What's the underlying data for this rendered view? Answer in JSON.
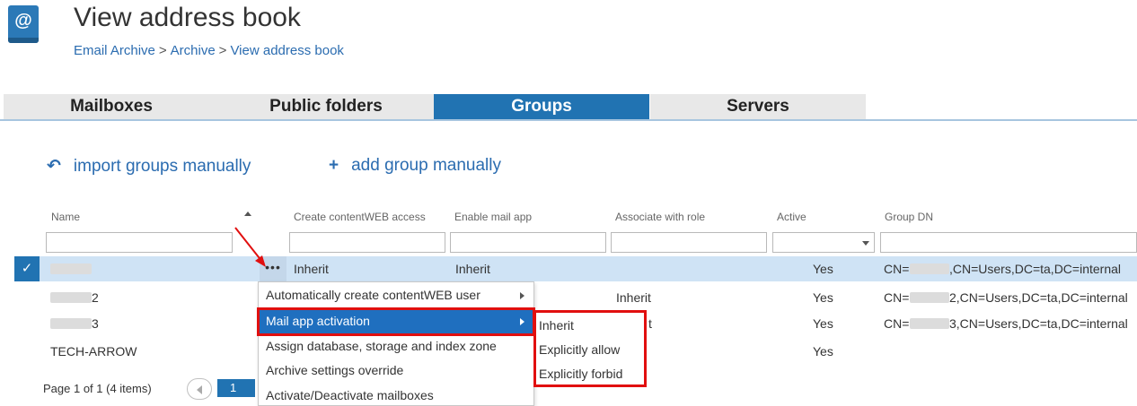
{
  "header": {
    "icon": "address-book-icon",
    "icon_glyph": "@",
    "title": "View address book",
    "breadcrumb": [
      "Email Archive",
      "Archive",
      "View address book"
    ],
    "breadcrumb_sep": ">"
  },
  "tabs": [
    {
      "label": "Mailboxes",
      "active": false
    },
    {
      "label": "Public folders",
      "active": false
    },
    {
      "label": "Groups",
      "active": true
    },
    {
      "label": "Servers",
      "active": false
    }
  ],
  "actions": [
    {
      "icon": "import-icon",
      "glyph": "↶",
      "label": "import groups manually"
    },
    {
      "icon": "add-icon",
      "glyph": "+",
      "label": "add group manually"
    }
  ],
  "grid": {
    "columns": [
      "Name",
      "Create contentWEB access",
      "Enable mail app",
      "Associate with role",
      "Active",
      "Group DN"
    ],
    "rows": [
      {
        "name": "",
        "create_access": "Inherit",
        "mail_app": "Inherit",
        "role": "",
        "active": "Yes",
        "dn_prefix": "CN=",
        "dn_suffix": ",CN=Users,DC=ta,DC=internal",
        "selected": true
      },
      {
        "name": "2",
        "create_access": "",
        "mail_app": "",
        "role": "Inherit",
        "active": "Yes",
        "dn_prefix": "CN=",
        "dn_suffix": "2,CN=Users,DC=ta,DC=internal",
        "selected": false
      },
      {
        "name": "3",
        "create_access": "",
        "mail_app": "",
        "role": "t",
        "active": "Yes",
        "dn_prefix": "CN=",
        "dn_suffix": "3,CN=Users,DC=ta,DC=internal",
        "selected": false
      },
      {
        "name": "TECH-ARROW",
        "create_access": "",
        "mail_app": "",
        "role": "",
        "active": "Yes",
        "dn_prefix": "",
        "dn_suffix": "",
        "selected": false
      }
    ],
    "row_menu_glyph": "•••",
    "check_glyph": "✓"
  },
  "pager": {
    "text": "Page 1 of 1 (4 items)",
    "current_page": "1"
  },
  "context_menu": {
    "items": [
      "Automatically create contentWEB user",
      "Mail app activation",
      "Assign database, storage and index zone",
      "Archive settings override",
      "Activate/Deactivate mailboxes"
    ],
    "highlighted": "Mail app activation",
    "submenu": [
      "Inherit",
      "Explicitly allow",
      "Explicitly forbid"
    ]
  },
  "colors": {
    "accent": "#2173b2",
    "highlight_box": "#e10f0f",
    "selected_row": "#cfe3f5"
  }
}
